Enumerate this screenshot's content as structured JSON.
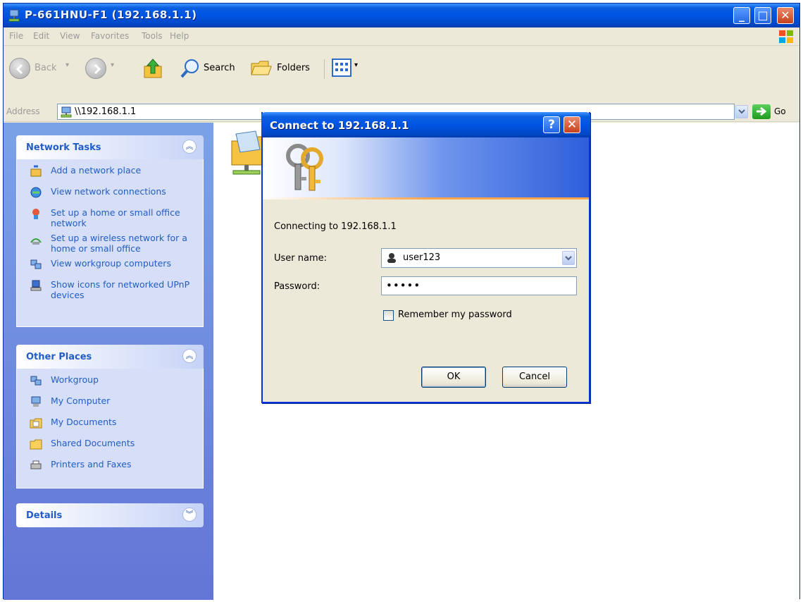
{
  "window": {
    "title": "P-661HNU-F1 (192.168.1.1)",
    "icon": "network-drive-icon"
  },
  "menu": [
    "File",
    "Edit",
    "View",
    "Favorites",
    "Tools",
    "Help"
  ],
  "toolbar": {
    "back_label": "Back",
    "search_label": "Search",
    "folders_label": "Folders"
  },
  "address": {
    "label": "Address",
    "value": "\\\\192.168.1.1",
    "go_label": "Go"
  },
  "taskpane": {
    "network_tasks": {
      "title": "Network Tasks",
      "items": [
        {
          "label": "Add a network place",
          "icon": "add-network-place-icon"
        },
        {
          "label": "View network connections",
          "icon": "network-connections-icon"
        },
        {
          "label": "Set up a home or small office network",
          "icon": "home-network-icon"
        },
        {
          "label": "Set up a wireless network for a home or small office",
          "icon": "wireless-network-icon"
        },
        {
          "label": "View workgroup computers",
          "icon": "workgroup-icon"
        },
        {
          "label": "Show icons for networked UPnP devices",
          "icon": "upnp-devices-icon"
        }
      ]
    },
    "other_places": {
      "title": "Other Places",
      "items": [
        {
          "label": "Workgroup",
          "icon": "workgroup-icon"
        },
        {
          "label": "My Computer",
          "icon": "my-computer-icon"
        },
        {
          "label": "My Documents",
          "icon": "my-documents-icon"
        },
        {
          "label": "Shared Documents",
          "icon": "shared-documents-icon"
        },
        {
          "label": "Printers and Faxes",
          "icon": "printers-icon"
        }
      ]
    },
    "details": {
      "title": "Details"
    }
  },
  "dialog": {
    "title": "Connect to 192.168.1.1",
    "connecting_text": "Connecting to 192.168.1.1",
    "username_label": "User name:",
    "username_value": "user123",
    "password_label": "Password:",
    "password_value": "•••••",
    "remember_label": "Remember my password",
    "remember_checked": false,
    "ok_label": "OK",
    "cancel_label": "Cancel"
  },
  "colors": {
    "titlebar_blue": "#0054e3",
    "taskpane_blue": "#6f8ddf",
    "link_blue": "#215dc6"
  }
}
